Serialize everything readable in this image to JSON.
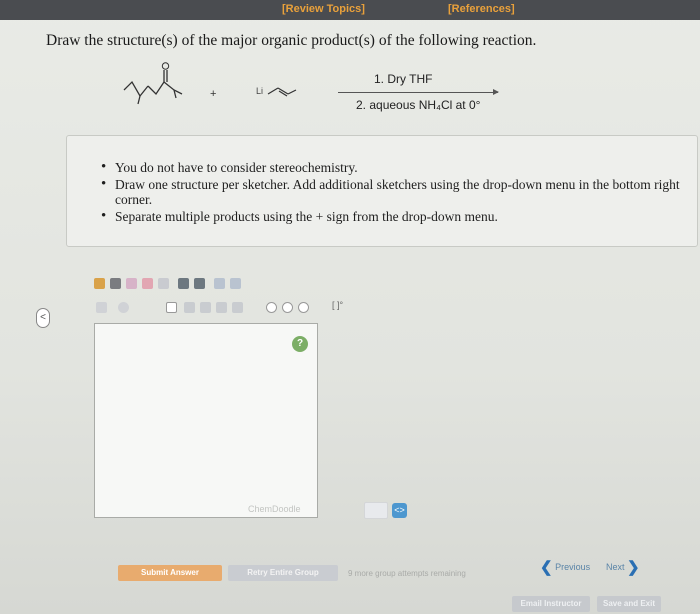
{
  "header": {
    "review_topics": "[Review Topics]",
    "references": "[References]"
  },
  "question": "Draw the structure(s) of the major organic product(s) of the following reaction.",
  "reaction": {
    "plus": "+",
    "reagent_label": "Li",
    "condition_1": "1. Dry THF",
    "condition_2": "2. aqueous NH₄Cl at 0°"
  },
  "instructions": [
    "You do not have to consider stereochemistry.",
    "Draw one structure per sketcher. Add additional sketchers using the drop-down menu in the bottom right corner.",
    "Separate multiple products using the + sign from the drop-down menu."
  ],
  "sketcher": {
    "watermark": "ChemDoodle",
    "help_glyph": "?",
    "toolbar_icons": [
      "undo-icon",
      "redo-icon",
      "eraser-icon",
      "lasso-icon",
      "rotate-icon",
      "zoom-in-icon",
      "zoom-out-icon",
      "clean-icon",
      "ring-icon"
    ],
    "toolbar2_text": "[ ]°",
    "toggle_glyph": "<"
  },
  "swap_glyph": "<>",
  "actions": {
    "submit": "Submit Answer",
    "retry": "Retry Entire Group",
    "attempts": "9 more group attempts remaining",
    "previous": "Previous",
    "next": "Next",
    "email": "Email Instructor",
    "save": "Save and Exit"
  },
  "colors": {
    "topbar": "#4a4c50",
    "link_orange": "#e9a13b",
    "submit": "#e8ab6e",
    "help_green": "#7cae66",
    "nav_blue": "#2a6fb3"
  }
}
